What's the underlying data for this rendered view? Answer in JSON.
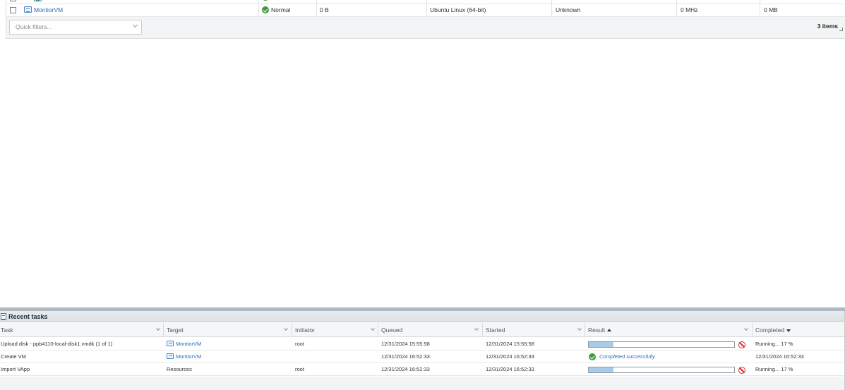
{
  "vm_grid": {
    "rows": [
      {
        "name": "",
        "status": "",
        "used_space": "",
        "guest_os": "",
        "host_name": "",
        "host_cpu": "",
        "host_memory": ""
      },
      {
        "name": "MontiorVM",
        "status": "Normal",
        "used_space": "0 B",
        "guest_os": "Ubuntu Linux (64-bit)",
        "host_name": "Unknown",
        "host_cpu": "0 MHz",
        "host_memory": "0 MB"
      }
    ],
    "quick_filter_placeholder": "Quick filters...",
    "items_count": "3 items"
  },
  "recent_tasks": {
    "title": "Recent tasks",
    "columns": {
      "task": "Task",
      "target": "Target",
      "initiator": "Initiator",
      "queued": "Queued",
      "started": "Started",
      "result": "Result",
      "completed": "Completed"
    },
    "rows": [
      {
        "task": "Upload disk - ppb4110-local-disk1.vmdk (1 of 1)",
        "target": "MontiorVM",
        "target_is_vm": true,
        "initiator": "root",
        "queued": "12/31/2024 15:55:58",
        "started": "12/31/2024 15:55:58",
        "result_type": "progress",
        "progress": 17,
        "result_text": "",
        "completed": "Running... 17 %"
      },
      {
        "task": "Create VM",
        "target": "MontiorVM",
        "target_is_vm": true,
        "initiator": "",
        "queued": "12/31/2024 16:52:33",
        "started": "12/31/2024 16:52:33",
        "result_type": "success",
        "progress": 100,
        "result_text": "Completed successfully",
        "completed": "12/31/2024 16:52:33"
      },
      {
        "task": "Import VApp",
        "target": "Resources",
        "target_is_vm": false,
        "initiator": "root",
        "queued": "12/31/2024 16:52:33",
        "started": "12/31/2024 16:52:33",
        "result_type": "progress",
        "progress": 17,
        "result_text": "",
        "completed": "Running... 17 %"
      }
    ]
  },
  "colors": {
    "link": "#2a6cb3",
    "ok_green": "#3d9b3d",
    "cancel_red": "#d42b2b",
    "progress_fill": "#a9cbe8"
  }
}
